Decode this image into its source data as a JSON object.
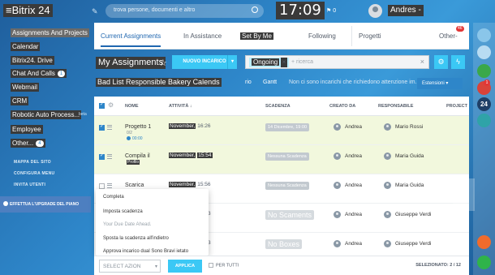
{
  "header": {
    "logo": "≡Bitrix 24",
    "search_placeholder": "trova persone, documenti e altro",
    "clock": "17:09",
    "flag_count": "0",
    "username": "Andres -"
  },
  "sidebar": {
    "items": [
      {
        "label": "Assignments And Projects",
        "count": ""
      },
      {
        "label": "Calendar",
        "count": ""
      },
      {
        "label": "Bitrix24. Drive",
        "count": ""
      },
      {
        "label": "Chat And Calls",
        "count": "1"
      },
      {
        "label": "Webmail",
        "count": ""
      },
      {
        "label": "CRM",
        "count": ""
      },
      {
        "label": "Robotic Auto Process...",
        "count": ""
      },
      {
        "label": "Employee",
        "count": ""
      },
      {
        "label": "Other...",
        "count": "4"
      }
    ],
    "beta": "beta",
    "links": [
      "MAPPA DEL SITO",
      "CONFIGURA MENU",
      "INVITA UTENTI"
    ],
    "upgrade": "EFFETTUA L'UPGRADE DEL PIANO"
  },
  "tabs": {
    "items": [
      "Current Assignments",
      "In Assistance",
      "Set By Me",
      "Following",
      "Progetti",
      "Other-"
    ],
    "badge": "46"
  },
  "titlebar": {
    "title": "My Assignments",
    "new_button": "NUOVO INCARICO",
    "chip": "Ongoing",
    "search_placeholder": "+ ricerca"
  },
  "toolbar2": {
    "left": "Bad List Responsible Bakery Calends",
    "rio": "rio",
    "gantt": "Gantt",
    "hint": "Non ci sono incarichi che richiedono attenzione im...",
    "extensions": "Estensioni"
  },
  "grid": {
    "headers": [
      "NOME",
      "ATTIVITÀ",
      "SCADENZA",
      "CREATO DA",
      "RESPONSABILE",
      "PROJECT"
    ],
    "rows": [
      {
        "name": "Progetto 1",
        "sub": "0/2",
        "time": "00:00",
        "activity_a": "November,",
        "activity_b": "16:26",
        "deadline": "14 Dicembre, 19:00",
        "creator": "Andrea",
        "responsible": "Mario Rossi"
      },
      {
        "name": "Compila il",
        "sub": "Profilo",
        "time": "",
        "activity_a": "November,",
        "activity_b": "15:54",
        "deadline": "Nessuna Scadenza",
        "creator": "Andrea",
        "responsible": "Maria Guida"
      },
      {
        "name": "Scarica",
        "sub": "",
        "time": "",
        "activity_a": "November,",
        "activity_b": "15:56",
        "deadline": "Nessuna Scadenza",
        "creator": "Andrea",
        "responsible": "Maria Guida"
      },
      {
        "name": "",
        "sub": "",
        "time": "",
        "activity_a": "",
        "activity_b": "3",
        "deadline": "No Scaments",
        "creator": "Andrea",
        "responsible": "Giuseppe Verdi"
      },
      {
        "name": "",
        "sub": "",
        "time": "",
        "activity_a": "",
        "activity_b": "3",
        "deadline": "No Boxes",
        "creator": "Andrea",
        "responsible": "Giuseppe Verdi"
      }
    ]
  },
  "popup": {
    "items": [
      "Completa",
      "Imposta scadenza",
      "Your Due Date Ahead.",
      "Sposta la scadenza all'indietro",
      "Approva incarico dual Sono Bravi ietato"
    ]
  },
  "footer": {
    "select_action": "SELECT AZION",
    "apply": "APPLICA",
    "per_tutti": "PER TUTTI",
    "selected": "SELEZIONATO: 2 / 12"
  },
  "right_strip": {
    "badges": [
      "1",
      "24"
    ]
  },
  "colors": {
    "accent": "#3bc8f5",
    "selected_row": "#f2f8dd",
    "brand_blue": "#2067b0"
  }
}
